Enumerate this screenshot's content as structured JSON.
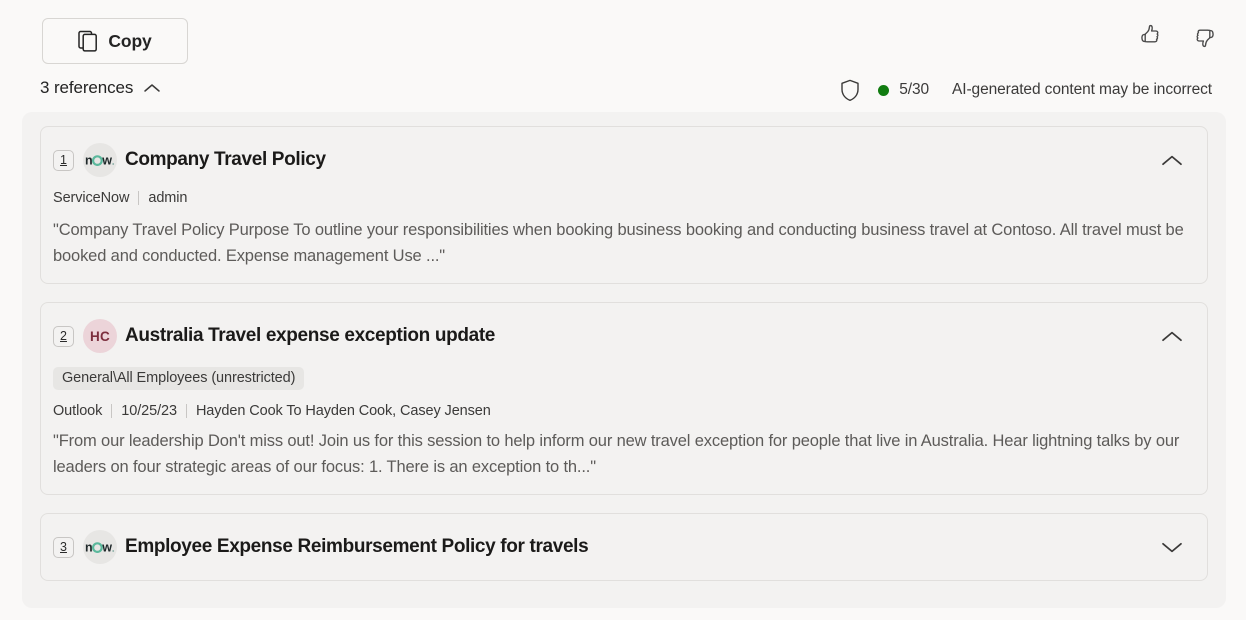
{
  "toolbar": {
    "copy_label": "Copy",
    "copy_icon": "copy-icon",
    "thumbs_up_icon": "thumbs-up-icon",
    "thumbs_down_icon": "thumbs-down-icon"
  },
  "references_header": {
    "label": "3 references",
    "chevron_icon": "chevron-up-icon",
    "expanded": true
  },
  "status": {
    "shield_icon": "shield-icon",
    "dot_color": "#107c10",
    "count": "5/30",
    "disclaimer": "AI-generated content may be incorrect"
  },
  "references": [
    {
      "number": "1",
      "avatar_type": "servicenow-logo",
      "avatar_text": "now",
      "title": "Company Travel Policy",
      "source": "ServiceNow",
      "author": "admin",
      "snippet": "\"Company Travel Policy Purpose To outline your responsibilities when booking business booking and conducting business travel at Contoso. All travel must be booked and conducted. Expense management Use ...\"",
      "chevron_icon": "chevron-up-icon",
      "expanded": true
    },
    {
      "number": "2",
      "avatar_type": "initials",
      "avatar_text": "HC",
      "avatar_bg": "#ecd4d9",
      "avatar_fg": "#7c2f3e",
      "title": "Australia Travel expense exception update",
      "tag": "General\\All Employees (unrestricted)",
      "source": "Outlook",
      "date": "10/25/23",
      "recipients": "Hayden Cook To Hayden Cook, Casey Jensen",
      "snippet": "\"From our leadership Don't miss out! Join us for this session to help inform our new travel exception for people that live in Australia. Hear lightning talks by our leaders on four strategic areas of our focus: 1. There is an exception to th...\"",
      "chevron_icon": "chevron-up-icon",
      "expanded": true
    },
    {
      "number": "3",
      "avatar_type": "servicenow-logo",
      "avatar_text": "now",
      "title": "Employee Expense Reimbursement Policy for travels",
      "chevron_icon": "chevron-down-icon",
      "expanded": false
    }
  ]
}
